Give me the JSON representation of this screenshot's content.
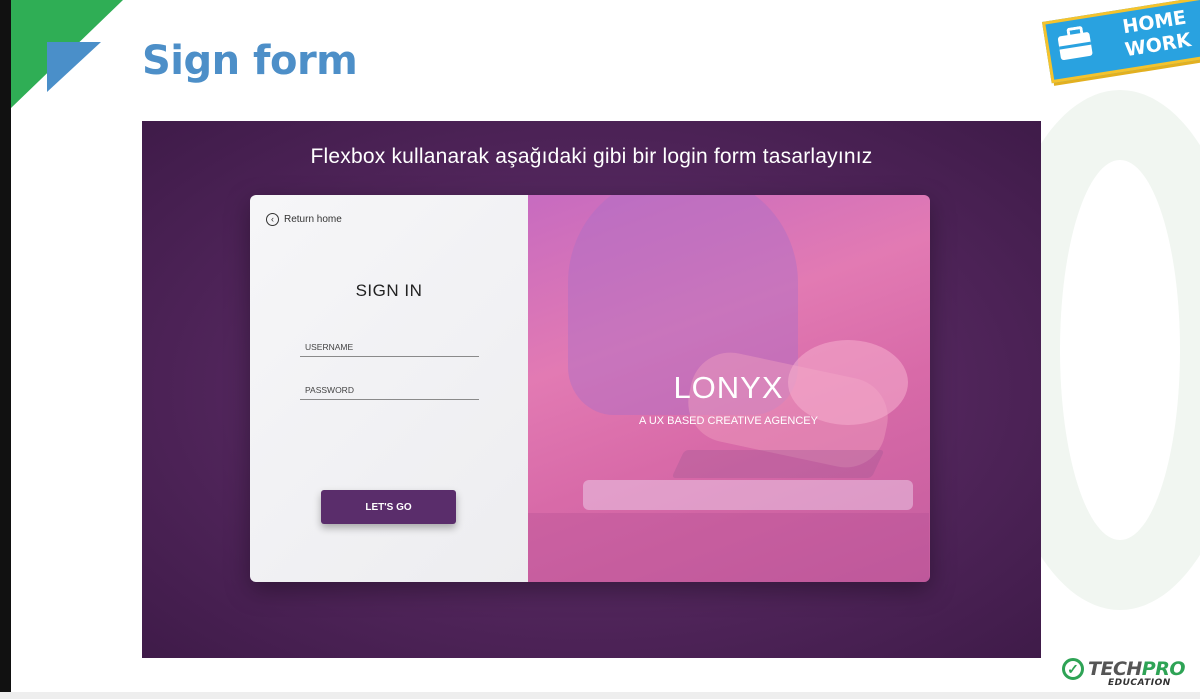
{
  "slide": {
    "title": "Sign form",
    "badge": {
      "line1": "HOME",
      "line2": "WORK",
      "icon": "briefcase-icon"
    }
  },
  "panel": {
    "instruction": "Flexbox kullanarak aşağıdaki gibi bir login form tasarlayınız"
  },
  "form": {
    "return_home": "Return home",
    "title": "SIGN IN",
    "username_placeholder": "USERNAME",
    "password_placeholder": "PASSWORD",
    "submit_label": "LET'S GO"
  },
  "hero": {
    "brand": "LONYX",
    "tagline": "A UX BASED CREATIVE AGENCEY"
  },
  "footer": {
    "logo_main_1": "TECH",
    "logo_main_2": "PRO",
    "logo_sub": "EDUCATION"
  },
  "colors": {
    "title_blue": "#4d8fc8",
    "panel_purple": "#4f2459",
    "button_purple": "#5a2d6b",
    "hero_pink": "#e27ab3",
    "brand_green": "#2ea355",
    "badge_blue": "#29a2e0",
    "badge_yellow": "#f5c32c"
  }
}
